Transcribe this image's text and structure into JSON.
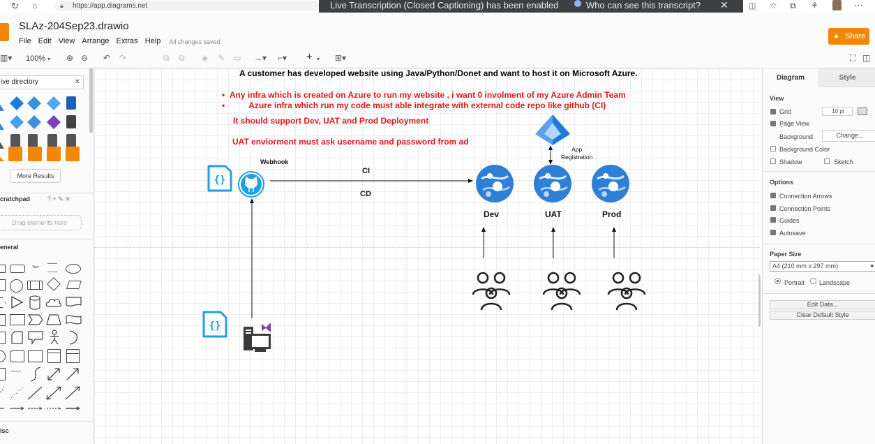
{
  "browser": {
    "url": "https://app.diagrams.net",
    "caption_text": "Live Transcription (Closed Captioning) has been enabled",
    "caption_link": "Who can see this transcript?"
  },
  "app": {
    "file_title": "SLAz-204Sep23.drawio",
    "menu": [
      "File",
      "Edit",
      "View",
      "Arrange",
      "Extras",
      "Help"
    ],
    "save_status": "All changes saved",
    "share_label": "Share",
    "accent": "#f08705"
  },
  "toolbar": {
    "zoom": "100%"
  },
  "left_panel": {
    "search_value": "ive directory",
    "more_results": "More Results",
    "scratchpad_title": "cratchpad",
    "scratchpad_icons": "? + ✎ ✕",
    "scratchpad_hint": "Drag elements here",
    "general_title": "eneral",
    "misc_title": "isc",
    "text_shape_label": "Text"
  },
  "diagram": {
    "heading": "A customer has developed website using Java/Python/Donet and want to host it on Microsoft Azure.",
    "bullet1": "Any infra which is created on Azure to run my website , i want 0 involment of my Azure Admin Team",
    "bullet2": "Azure infra which run my code must able integrate with external code repo like github (CI)",
    "req1": "It should support Dev, UAT and Prod Deployment",
    "req2": "UAT enviorment must ask username and password from ad",
    "webhook": "Webhook",
    "ci": "CI",
    "cd": "CD",
    "app_registration": "App\nRegistration",
    "env_dev": "Dev",
    "env_uat": "UAT",
    "env_prod": "Prod",
    "red": "#e0161c",
    "azure_blue": "#1e7ad6"
  },
  "right_panel": {
    "tab_diagram": "Diagram",
    "tab_style": "Style",
    "view_title": "View",
    "grid": "Grid",
    "grid_size": "10 pt",
    "page_view": "Page View",
    "background": "Background",
    "change": "Change...",
    "background_color": "Background Color",
    "shadow": "Shadow",
    "sketch": "Sketch",
    "options_title": "Options",
    "connection_arrows": "Connection Arrows",
    "connection_points": "Connection Points",
    "guides": "Guides",
    "autosave": "Autosave",
    "paper_title": "Paper Size",
    "paper_value": "A4 (210 mm x 297 mm)",
    "portrait": "Portrait",
    "landscape": "Landscape",
    "edit_data": "Edit Data...",
    "clear_style": "Clear Default Style"
  }
}
